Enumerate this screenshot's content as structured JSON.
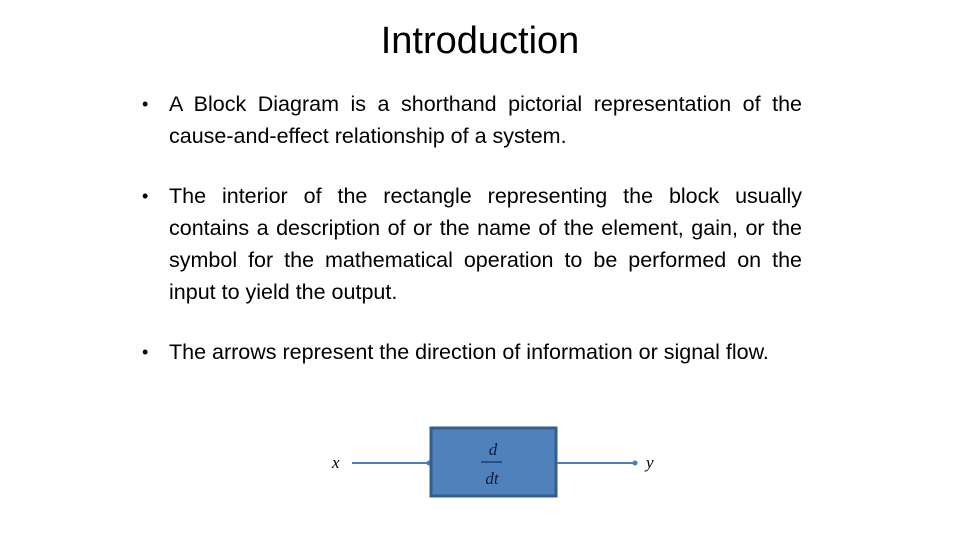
{
  "slide": {
    "title": "Introduction",
    "bullets": [
      {
        "text": "A Block Diagram is a shorthand pictorial representation of the cause-and-effect relationship of a system."
      },
      {
        "text": "The interior of the rectangle representing the block usually contains a description of or the name of the element, gain, or the symbol for the mathematical operation to be performed on the input to yield the output."
      },
      {
        "text": "The arrows represent the direction of information or signal flow."
      }
    ],
    "bullet_glyph": "•",
    "diagram": {
      "input_label": "x",
      "output_label": "y",
      "block_numerator": "d",
      "block_denominator": "dt",
      "block_fill": "#4F81BD",
      "block_border": "#385D8A",
      "line_color": "#4A7EBB"
    }
  }
}
